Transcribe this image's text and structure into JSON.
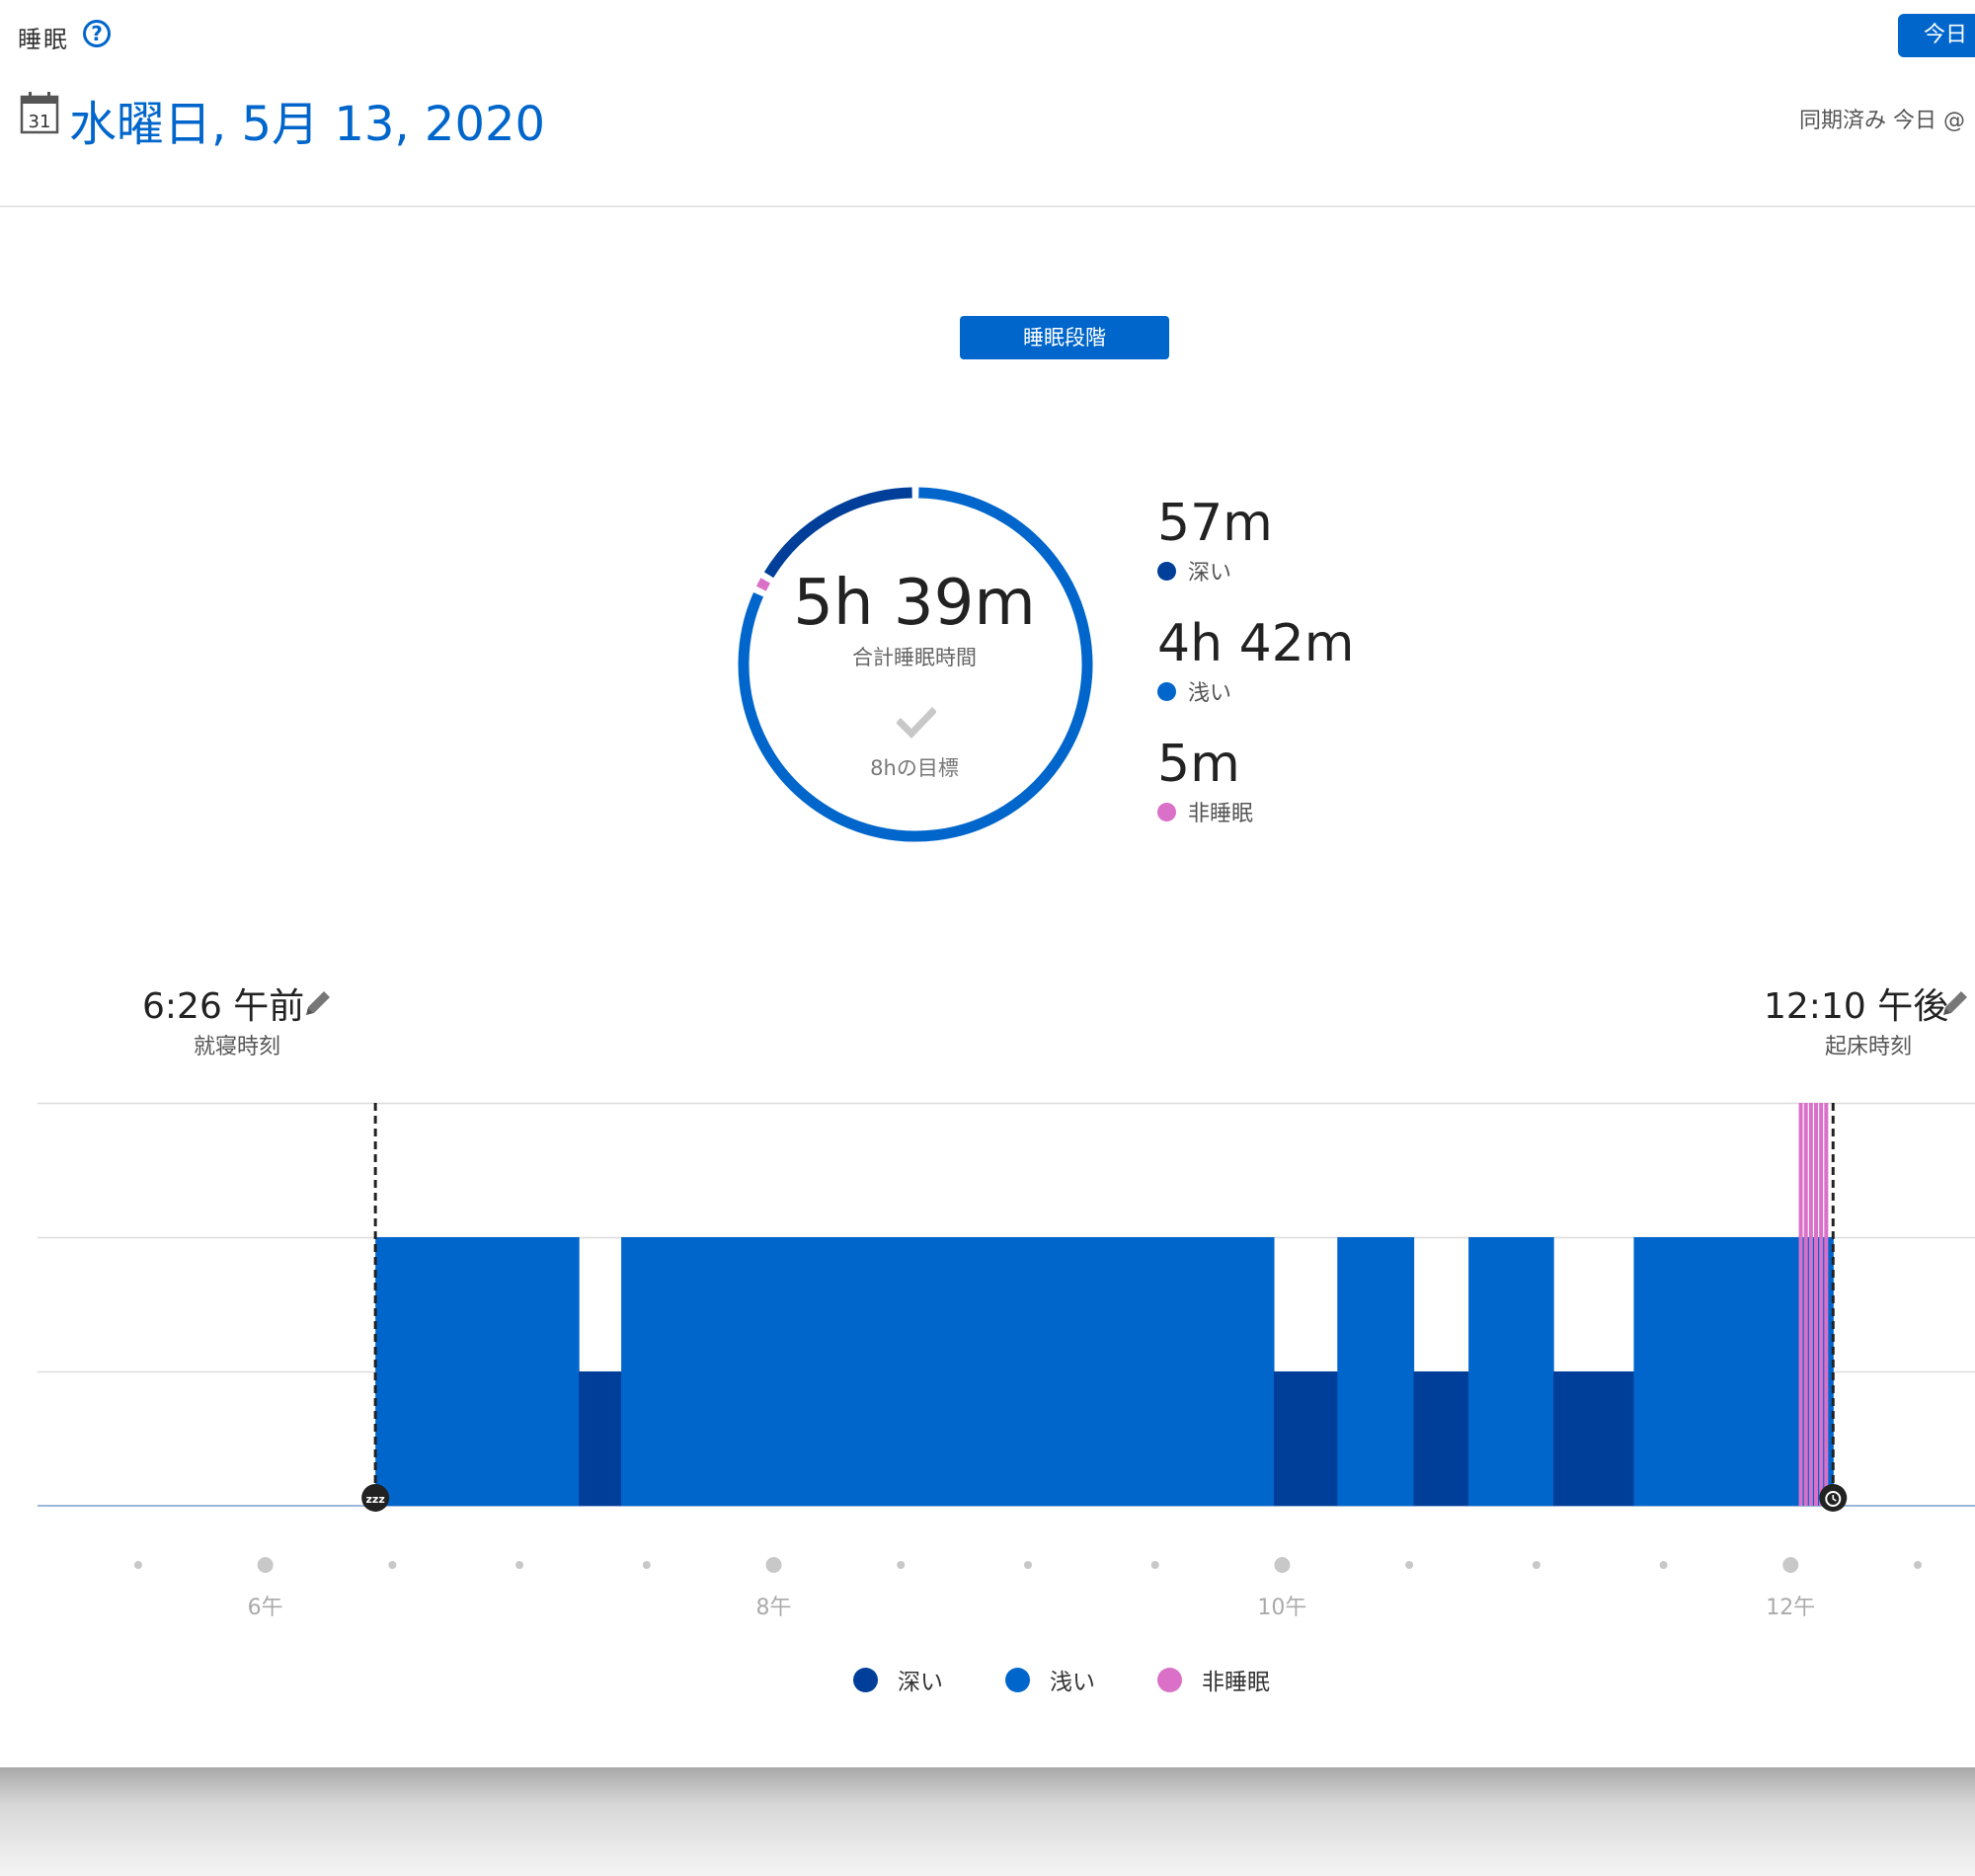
{
  "header": {
    "app_title": "睡眠",
    "help_icon": "question-circle-icon",
    "today_button": "今日",
    "date": "水曜日, 5月 13, 2020",
    "calendar_icon_day": "31",
    "sync_status": "同期済み 今日 @"
  },
  "controls": {
    "sleep_stages_button": "睡眠段階"
  },
  "summary": {
    "total_value": "5h 39m",
    "total_label": "合計睡眠時間",
    "goal_label": "8hの目標",
    "goal_icon": "checkmark-icon"
  },
  "stats": [
    {
      "value": "57m",
      "label": "深い",
      "color": "#003f99"
    },
    {
      "value": "4h 42m",
      "label": "浅い",
      "color": "#0066cc"
    },
    {
      "value": "5m",
      "label": "非睡眠",
      "color": "#da70c8"
    }
  ],
  "times": {
    "bedtime_value": "6:26 午前",
    "bedtime_label": "就寝時刻",
    "waketime_value": "12:10 午後",
    "waketime_label": "起床時刻",
    "edit_icon": "pencil-icon"
  },
  "colors": {
    "deep": "#003f99",
    "light": "#0066cc",
    "awake": "#da70c8",
    "accent": "#0066cc"
  },
  "chart_data": {
    "type": "bar",
    "title": "",
    "x_unit": "hours (clock time)",
    "xlim": [
      5.17,
      12.5
    ],
    "x_ticks": [
      {
        "value": 6,
        "label": "6午"
      },
      {
        "value": 8,
        "label": "8午"
      },
      {
        "value": 10,
        "label": "10午"
      },
      {
        "value": 12,
        "label": "12午"
      }
    ],
    "stage_levels": {
      "deep": 1,
      "light": 2,
      "awake": 3
    },
    "bedtime": 6.433,
    "waketime": 12.167,
    "segments": [
      {
        "start": 6.433,
        "end": 7.233,
        "stage": "light"
      },
      {
        "start": 7.233,
        "end": 7.4,
        "stage": "deep"
      },
      {
        "start": 7.4,
        "end": 9.967,
        "stage": "light"
      },
      {
        "start": 9.967,
        "end": 10.217,
        "stage": "deep"
      },
      {
        "start": 10.217,
        "end": 10.517,
        "stage": "light"
      },
      {
        "start": 10.517,
        "end": 10.733,
        "stage": "deep"
      },
      {
        "start": 10.733,
        "end": 11.067,
        "stage": "light"
      },
      {
        "start": 11.067,
        "end": 11.383,
        "stage": "deep"
      },
      {
        "start": 11.383,
        "end": 12.033,
        "stage": "light"
      },
      {
        "start": 12.033,
        "end": 12.167,
        "stage": "light"
      }
    ],
    "awake_marks": [
      12.04,
      12.06,
      12.08,
      12.1,
      12.12,
      12.14
    ],
    "donut": [
      {
        "stage": "light",
        "minutes": 282
      },
      {
        "stage": "awake",
        "minutes": 5
      },
      {
        "stage": "deep",
        "minutes": 57
      }
    ],
    "legend": [
      {
        "name": "深い",
        "stage": "deep"
      },
      {
        "name": "浅い",
        "stage": "light"
      },
      {
        "name": "非睡眠",
        "stage": "awake"
      }
    ],
    "legend_position": "bottom-center"
  }
}
